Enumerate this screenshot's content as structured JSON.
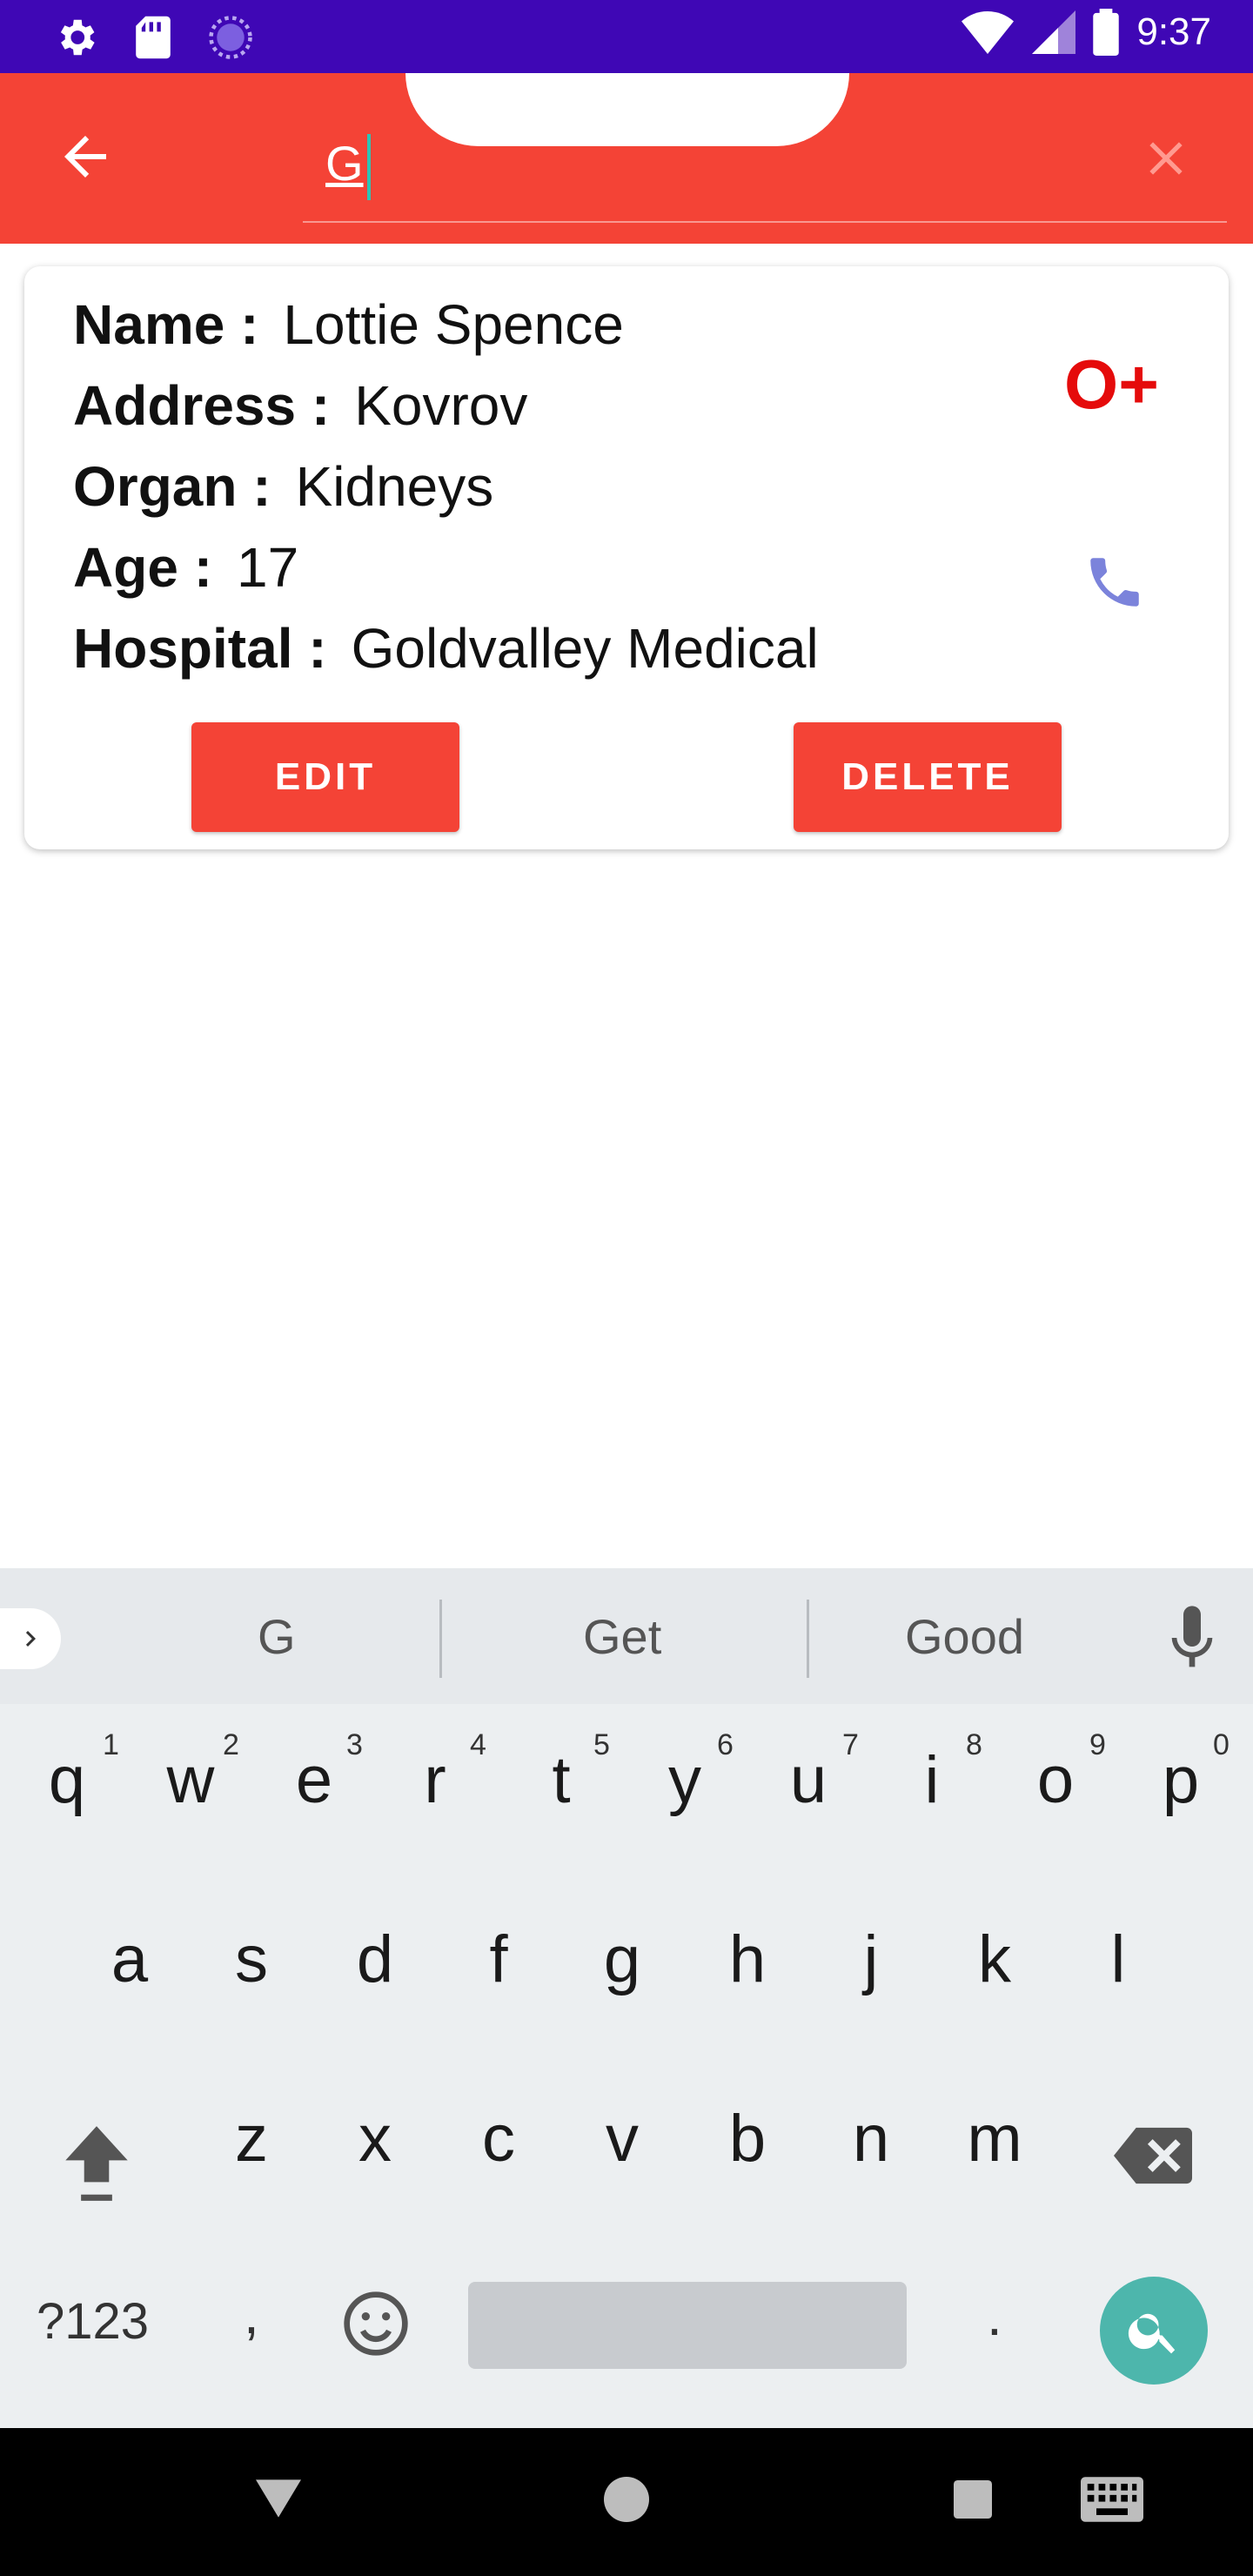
{
  "status_bar": {
    "time": "9:37",
    "icons": [
      "settings-icon",
      "sd-card-icon",
      "sync-icon",
      "wifi-icon",
      "signal-icon",
      "battery-icon"
    ]
  },
  "app_bar": {
    "search_value": "G",
    "icons": {
      "back": "arrow-left-icon",
      "clear": "close-icon"
    },
    "color": "#f44336"
  },
  "card": {
    "fields": [
      {
        "label": "Name :",
        "value": "Lottie Spence"
      },
      {
        "label": "Address :",
        "value": "Kovrov"
      },
      {
        "label": "Organ :",
        "value": "Kidneys"
      },
      {
        "label": "Age :",
        "value": "17"
      },
      {
        "label": "Hospital :",
        "value": "Goldvalley Medical"
      }
    ],
    "blood_group": "O+",
    "edit_label": "EDIT",
    "delete_label": "DELETE",
    "phone_icon": "phone-icon"
  },
  "keyboard": {
    "suggestions": [
      "G",
      "Get",
      "Good"
    ],
    "row1": [
      "q",
      "w",
      "e",
      "r",
      "t",
      "y",
      "u",
      "i",
      "o",
      "p"
    ],
    "row1_hints": [
      "1",
      "2",
      "3",
      "4",
      "5",
      "6",
      "7",
      "8",
      "9",
      "0"
    ],
    "row2": [
      "a",
      "s",
      "d",
      "f",
      "g",
      "h",
      "j",
      "k",
      "l"
    ],
    "row3": [
      "z",
      "x",
      "c",
      "v",
      "b",
      "n",
      "m"
    ],
    "symbols_label": "?123",
    "comma": ",",
    "period": "."
  }
}
